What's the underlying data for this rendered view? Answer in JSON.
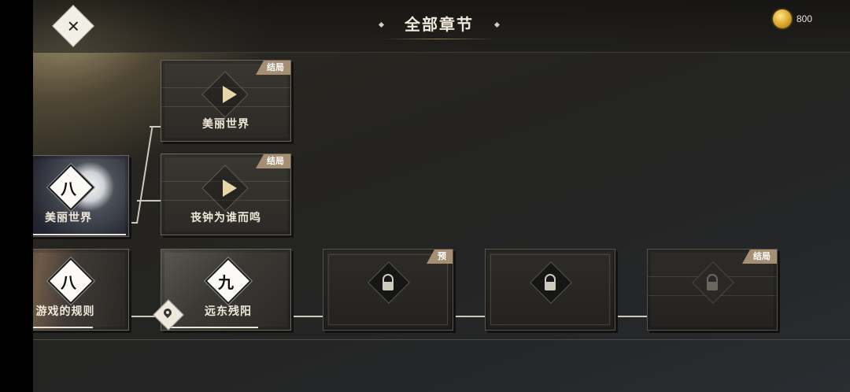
{
  "header": {
    "title": "全部章节",
    "coins": "800",
    "close_icon_glyph": "✕"
  },
  "colors": {
    "tag_bg": "#a48f72",
    "play_icon": "#e6d7a8",
    "background": "#24231f"
  },
  "upper_branch": {
    "chapter_card": {
      "number": "八",
      "label": "美丽世界"
    },
    "endings": [
      {
        "tag": "结局",
        "label": "美丽世界",
        "icon": "play-icon"
      },
      {
        "tag": "结局",
        "label": "丧钟为谁而鸣",
        "icon": "play-icon"
      }
    ]
  },
  "lower_row": {
    "chapters": [
      {
        "number": "八",
        "label": "游戏的规则"
      },
      {
        "number": "九",
        "label": "远东残阳"
      }
    ],
    "locked": [
      {
        "tag": "预",
        "icon": "lock-icon"
      },
      {
        "tag": "",
        "icon": "lock-icon"
      },
      {
        "tag": "结局",
        "icon": "lock-icon"
      }
    ],
    "current_marker_icon": "location-pin-icon"
  }
}
